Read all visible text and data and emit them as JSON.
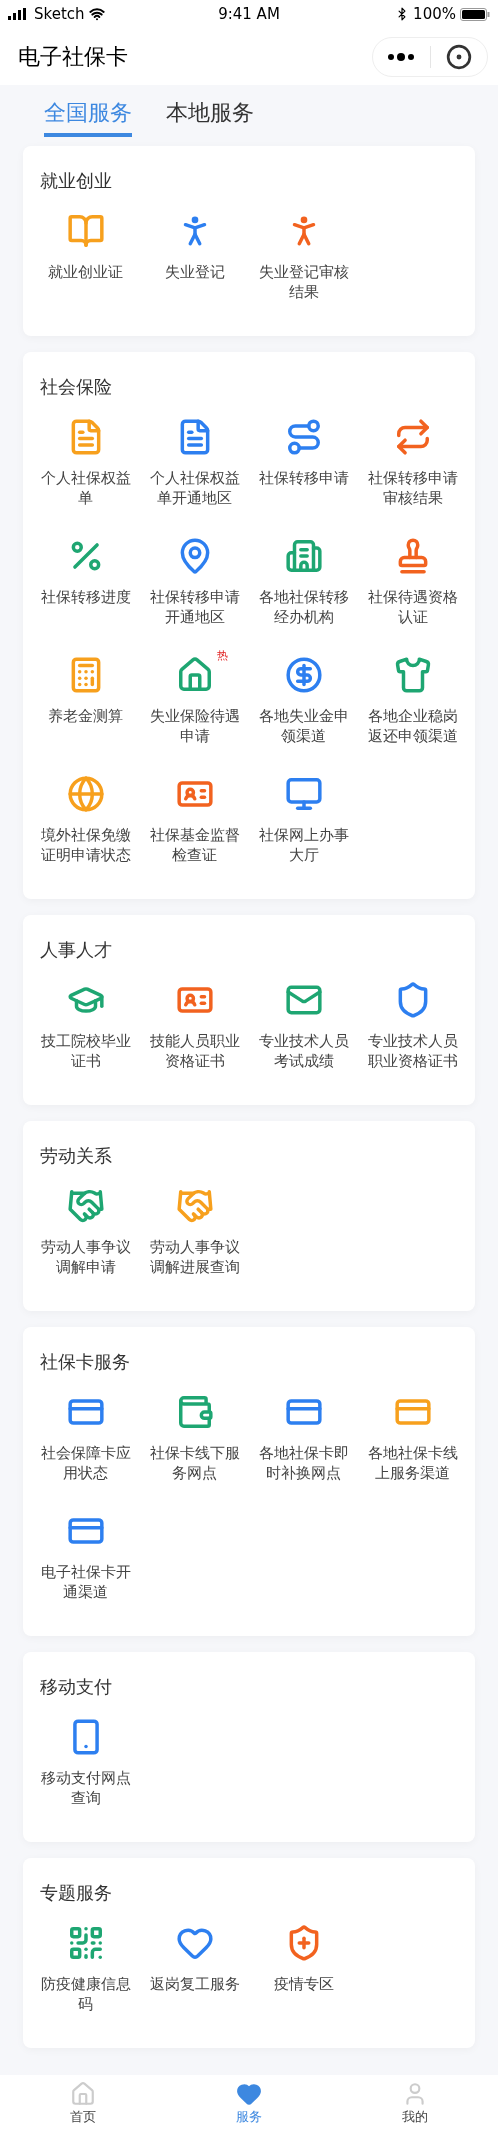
{
  "status_bar": {
    "carrier": "Sketch",
    "time": "9:41 AM",
    "battery": "100%"
  },
  "nav_bar": {
    "title": "电子社保卡"
  },
  "tabs": [
    {
      "label": "全国服务",
      "selected": true
    },
    {
      "label": "本地服务",
      "selected": false
    }
  ],
  "sections": [
    {
      "title": "就业创业",
      "items": [
        {
          "label": "就业创业证",
          "kind": "book",
          "color": "#f7a01d"
        },
        {
          "label": "失业登记",
          "kind": "person",
          "color": "#2d7ff0"
        },
        {
          "label": "失业登记审核结果",
          "kind": "person",
          "color": "#f2621f"
        }
      ]
    },
    {
      "title": "社会保险",
      "items": [
        {
          "label": "个人社保权益单",
          "kind": "document",
          "color": "#f7a01d"
        },
        {
          "label": "个人社保权益单开通地区",
          "kind": "document",
          "color": "#2d7ff0"
        },
        {
          "label": "社保转移申请",
          "kind": "route",
          "color": "#2d7ff0"
        },
        {
          "label": "社保转移申请审核结果",
          "kind": "repeat",
          "color": "#f2621f"
        },
        {
          "label": "社保转移进度",
          "kind": "percent",
          "color": "#1ea672"
        },
        {
          "label": "社保转移申请开通地区",
          "kind": "pin",
          "color": "#2d7ff0"
        },
        {
          "label": "各地社保转移经办机构",
          "kind": "building",
          "color": "#1ea672"
        },
        {
          "label": "社保待遇资格认证",
          "kind": "stamp",
          "color": "#f2621f"
        },
        {
          "label": "养老金测算",
          "kind": "calculator",
          "color": "#f7a01d"
        },
        {
          "label": "失业保险待遇申请",
          "kind": "house",
          "color": "#1ea672",
          "badge": "热"
        },
        {
          "label": "各地失业金申领渠道",
          "kind": "coin",
          "color": "#2d7ff0"
        },
        {
          "label": "各地企业稳岗返还申领渠道",
          "kind": "shirt",
          "color": "#1ea672"
        },
        {
          "label": "境外社保免缴证明申请状态",
          "kind": "globe",
          "color": "#f7a01d"
        },
        {
          "label": "社保基金监督检查证",
          "kind": "idcard",
          "color": "#f2621f"
        },
        {
          "label": "社保网上办事大厅",
          "kind": "monitor",
          "color": "#2d7ff0"
        }
      ]
    },
    {
      "title": "人事人才",
      "items": [
        {
          "label": "技工院校毕业证书",
          "kind": "cap",
          "color": "#1ea672"
        },
        {
          "label": "技能人员职业资格证书",
          "kind": "idcard",
          "color": "#f2621f"
        },
        {
          "label": "专业技术人员考试成绩",
          "kind": "mail",
          "color": "#1ea672"
        },
        {
          "label": "专业技术人员职业资格证书",
          "kind": "shield",
          "color": "#2d7ff0"
        }
      ]
    },
    {
      "title": "劳动关系",
      "items": [
        {
          "label": "劳动人事争议调解申请",
          "kind": "handshake",
          "color": "#1ea672"
        },
        {
          "label": "劳动人事争议调解进展查询",
          "kind": "handshake",
          "color": "#f7a01d"
        }
      ]
    },
    {
      "title": "社保卡服务",
      "items": [
        {
          "label": "社会保障卡应用状态",
          "kind": "card",
          "color": "#2d7ff0"
        },
        {
          "label": "社保卡线下服务网点",
          "kind": "wallet",
          "color": "#1ea672"
        },
        {
          "label": "各地社保卡即时补换网点",
          "kind": "card",
          "color": "#2d7ff0"
        },
        {
          "label": "各地社保卡线上服务渠道",
          "kind": "card",
          "color": "#f7a01d"
        },
        {
          "label": "电子社保卡开通渠道",
          "kind": "card",
          "color": "#2d7ff0"
        }
      ]
    },
    {
      "title": "移动支付",
      "items": [
        {
          "label": "移动支付网点查询",
          "kind": "phone",
          "color": "#2d7ff0"
        }
      ]
    },
    {
      "title": "专题服务",
      "items": [
        {
          "label": "防疫健康信息码",
          "kind": "qr",
          "color": "#1ea672"
        },
        {
          "label": "返岗复工服务",
          "kind": "heart",
          "color": "#2d7ff0"
        },
        {
          "label": "疫情专区",
          "kind": "shieldplus",
          "color": "#f2621f"
        }
      ]
    }
  ],
  "bottom_tabs": [
    {
      "label": "首页",
      "kind": "home",
      "selected": false
    },
    {
      "label": "服务",
      "kind": "heart",
      "selected": true
    },
    {
      "label": "我的",
      "kind": "user",
      "selected": false
    }
  ]
}
